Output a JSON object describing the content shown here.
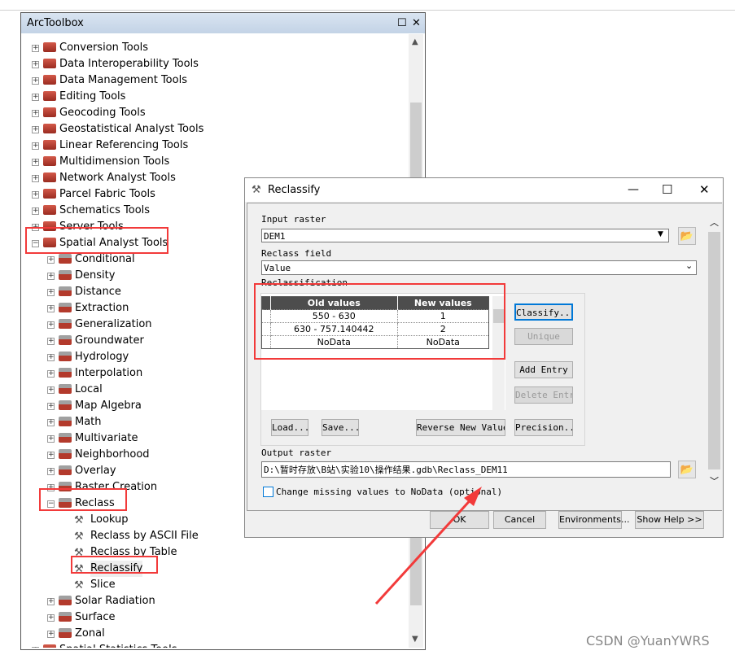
{
  "toolbox": {
    "title": "ArcToolbox",
    "items": [
      {
        "label": "Conversion Tools",
        "level": 0,
        "type": "toolbox",
        "expanded": false
      },
      {
        "label": "Data Interoperability Tools",
        "level": 0,
        "type": "toolbox",
        "expanded": false
      },
      {
        "label": "Data Management Tools",
        "level": 0,
        "type": "toolbox",
        "expanded": false
      },
      {
        "label": "Editing Tools",
        "level": 0,
        "type": "toolbox",
        "expanded": false
      },
      {
        "label": "Geocoding Tools",
        "level": 0,
        "type": "toolbox",
        "expanded": false
      },
      {
        "label": "Geostatistical Analyst Tools",
        "level": 0,
        "type": "toolbox",
        "expanded": false
      },
      {
        "label": "Linear Referencing Tools",
        "level": 0,
        "type": "toolbox",
        "expanded": false
      },
      {
        "label": "Multidimension Tools",
        "level": 0,
        "type": "toolbox",
        "expanded": false
      },
      {
        "label": "Network Analyst Tools",
        "level": 0,
        "type": "toolbox",
        "expanded": false
      },
      {
        "label": "Parcel Fabric Tools",
        "level": 0,
        "type": "toolbox",
        "expanded": false
      },
      {
        "label": "Schematics Tools",
        "level": 0,
        "type": "toolbox",
        "expanded": false
      },
      {
        "label": "Server Tools",
        "level": 0,
        "type": "toolbox",
        "expanded": false
      },
      {
        "label": "Spatial Analyst Tools",
        "level": 0,
        "type": "toolbox",
        "expanded": true
      },
      {
        "label": "Conditional",
        "level": 1,
        "type": "toolset",
        "expanded": false
      },
      {
        "label": "Density",
        "level": 1,
        "type": "toolset",
        "expanded": false
      },
      {
        "label": "Distance",
        "level": 1,
        "type": "toolset",
        "expanded": false
      },
      {
        "label": "Extraction",
        "level": 1,
        "type": "toolset",
        "expanded": false
      },
      {
        "label": "Generalization",
        "level": 1,
        "type": "toolset",
        "expanded": false
      },
      {
        "label": "Groundwater",
        "level": 1,
        "type": "toolset",
        "expanded": false
      },
      {
        "label": "Hydrology",
        "level": 1,
        "type": "toolset",
        "expanded": false
      },
      {
        "label": "Interpolation",
        "level": 1,
        "type": "toolset",
        "expanded": false
      },
      {
        "label": "Local",
        "level": 1,
        "type": "toolset",
        "expanded": false
      },
      {
        "label": "Map Algebra",
        "level": 1,
        "type": "toolset",
        "expanded": false
      },
      {
        "label": "Math",
        "level": 1,
        "type": "toolset",
        "expanded": false
      },
      {
        "label": "Multivariate",
        "level": 1,
        "type": "toolset",
        "expanded": false
      },
      {
        "label": "Neighborhood",
        "level": 1,
        "type": "toolset",
        "expanded": false
      },
      {
        "label": "Overlay",
        "level": 1,
        "type": "toolset",
        "expanded": false
      },
      {
        "label": "Raster Creation",
        "level": 1,
        "type": "toolset",
        "expanded": false
      },
      {
        "label": "Reclass",
        "level": 1,
        "type": "toolset",
        "expanded": true
      },
      {
        "label": "Lookup",
        "level": 2,
        "type": "tool"
      },
      {
        "label": "Reclass by ASCII File",
        "level": 2,
        "type": "tool"
      },
      {
        "label": "Reclass by Table",
        "level": 2,
        "type": "tool"
      },
      {
        "label": "Reclassify",
        "level": 2,
        "type": "tool",
        "selected": true
      },
      {
        "label": "Slice",
        "level": 2,
        "type": "tool"
      },
      {
        "label": "Solar Radiation",
        "level": 1,
        "type": "toolset",
        "expanded": false
      },
      {
        "label": "Surface",
        "level": 1,
        "type": "toolset",
        "expanded": false
      },
      {
        "label": "Zonal",
        "level": 1,
        "type": "toolset",
        "expanded": false
      },
      {
        "label": "Spatial Statistics Tools",
        "level": 0,
        "type": "toolbox",
        "expanded": false
      }
    ]
  },
  "dialog": {
    "title": "Reclassify",
    "input_raster_label": "Input raster",
    "input_raster": "DEM1",
    "reclass_field_label": "Reclass field",
    "reclass_field": "Value",
    "reclassification_label": "Reclassification",
    "table": {
      "headers": [
        "Old values",
        "New values"
      ],
      "rows": [
        [
          "550 - 630",
          "1"
        ],
        [
          "630 - 757.140442",
          "2"
        ],
        [
          "NoData",
          "NoData"
        ]
      ]
    },
    "buttons": {
      "classify": "Classify...",
      "unique": "Unique",
      "add_entry": "Add Entry",
      "delete_entries": "Delete Entries",
      "load": "Load...",
      "save": "Save...",
      "reverse": "Reverse New Values",
      "precision": "Precision..."
    },
    "output_raster_label": "Output raster",
    "output_raster": "D:\\暂时存放\\B站\\实验10\\操作结果.gdb\\Reclass_DEM11",
    "missing_checkbox": "Change missing values to NoData (optional)",
    "missing_checked": false,
    "footer": {
      "ok": "OK",
      "cancel": "Cancel",
      "environments": "Environments...",
      "show_help": "Show Help >>"
    }
  },
  "watermark": "CSDN @YuanYWRS",
  "colors": {
    "annotation": "#f23a3a",
    "header": "#4d4d4d",
    "focus": "#0078d7"
  }
}
